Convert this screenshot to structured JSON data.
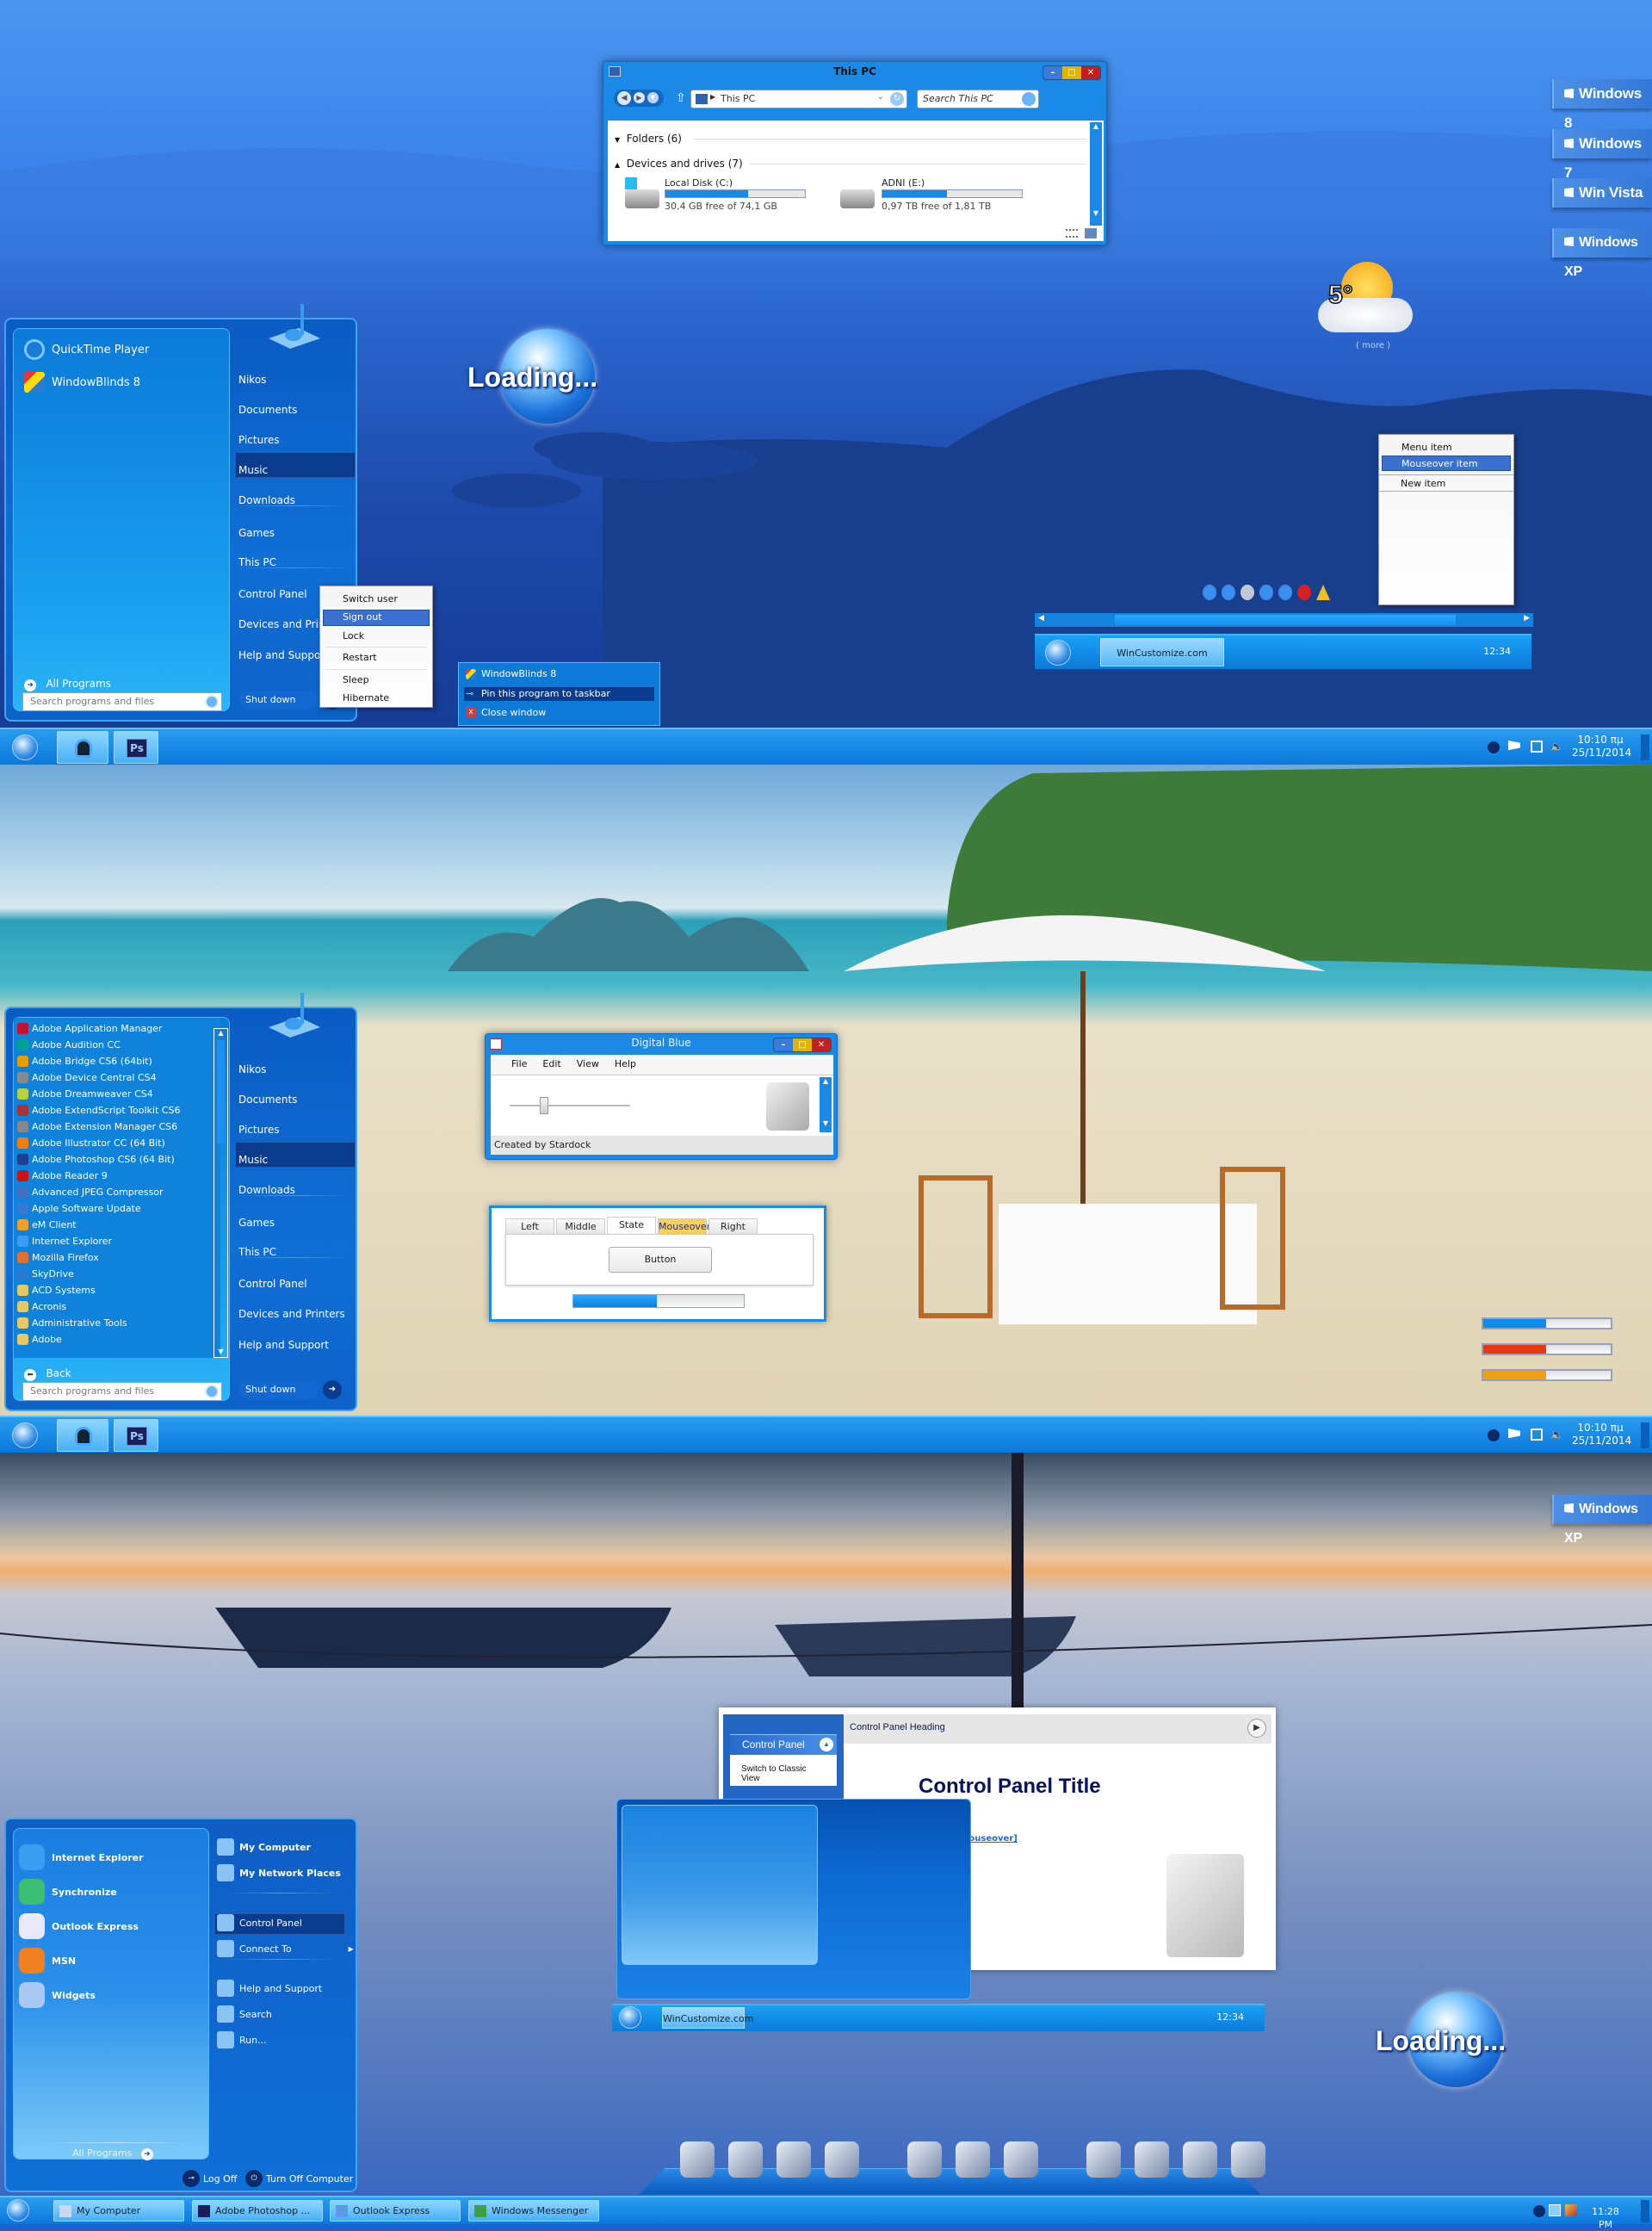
{
  "colors": {
    "accent": "#1a8ae6",
    "highlight": "#0a3b8c",
    "menu_hover": "#3a70d0",
    "progress_blue": "#0d8cee",
    "progress_red": "#e83812",
    "progress_orange": "#f0a010"
  },
  "explorer": {
    "title": "This PC",
    "address": "This PC",
    "search_placeholder": "Search This PC",
    "groups": [
      {
        "label": "Folders (6)",
        "expanded": false
      },
      {
        "label": "Devices and drives (7)",
        "expanded": true
      }
    ],
    "drives": [
      {
        "name": "Local Disk (C:)",
        "free_text": "30,4 GB free of 74,1 GB",
        "used_fraction": 0.59,
        "icon": "windows-drive-icon"
      },
      {
        "name": "ADNI (E:)",
        "free_text": "0,97 TB free of 1,81 TB",
        "used_fraction": 0.46,
        "icon": "hard-drive-icon"
      }
    ]
  },
  "start_menu_1": {
    "pinned": [
      {
        "label": "QuickTime Player",
        "icon": "quicktime-icon"
      },
      {
        "label": "WindowBlinds 8",
        "icon": "windowblinds-icon"
      }
    ],
    "all_programs": "All Programs",
    "search_placeholder": "Search programs and files",
    "right": [
      "Nikos",
      "Documents",
      "Pictures",
      "Music",
      "Downloads",
      "Games",
      "This PC",
      "Control Panel",
      "Devices and Printers",
      "Help and Support"
    ],
    "selected": "Music",
    "shutdown": "Shut down"
  },
  "shutdown_menu": {
    "items": [
      "Switch user",
      "Sign out",
      "Lock",
      "Restart",
      "Sleep",
      "Hibernate"
    ],
    "hover": "Sign out"
  },
  "loading_text": "Loading...",
  "jump_list": {
    "title": "WindowBlinds 8",
    "items": [
      "Pin this program to taskbar",
      "Close window"
    ]
  },
  "desktop_buttons": [
    "Windows 8",
    "Windows 7",
    "Win Vista",
    "Windows XP"
  ],
  "weather": {
    "temp": "5°",
    "more": "( more )",
    "icon": "partly-cloudy-icon"
  },
  "context_menu": {
    "items": [
      "Menu item",
      "Mouseover item",
      "New item"
    ],
    "hover": "Mouseover item"
  },
  "toolbar_icons": [
    "add-icon",
    "forward-icon",
    "new-folder-icon",
    "tag-icon",
    "up-icon",
    "remove-icon",
    "warning-icon"
  ],
  "mini_taskbar": {
    "button": "WinCustomize.com",
    "clock": "12:34"
  },
  "taskbar": {
    "time": "10:10 πμ",
    "date": "25/11/2014",
    "pinned": [
      "user-icon",
      "photoshop-icon"
    ],
    "tray": [
      "show-hidden-icon",
      "action-center-icon",
      "network-icon",
      "volume-icon"
    ]
  },
  "start_menu_2": {
    "programs": [
      "Adobe Application Manager",
      "Adobe Audition CC",
      "Adobe Bridge CS6 (64bit)",
      "Adobe Device Central CS4",
      "Adobe Dreamweaver CS4",
      "Adobe ExtendScript Toolkit CS6",
      "Adobe Extension Manager CS6",
      "Adobe Illustrator CC (64 Bit)",
      "Adobe Photoshop CS6 (64 Bit)",
      "Adobe Reader 9",
      "Advanced JPEG Compressor",
      "Apple Software Update",
      "eM Client",
      "Internet Explorer",
      "Mozilla Firefox",
      "SkyDrive",
      "ACD Systems",
      "Acronis",
      "Administrative Tools",
      "Adobe"
    ],
    "program_colors": [
      "#c8102e",
      "#00a38c",
      "#e89c00",
      "#8a8a8a",
      "#b6d33a",
      "#a33",
      "#888",
      "#ff7b00",
      "#1c3f94",
      "#d01010",
      "#4070c0",
      "#3a78d0",
      "#f0a020",
      "#3a9ef0",
      "#e8702a",
      "#2a7ad0",
      "#e8c860",
      "#e8c860",
      "#e8c860",
      "#e8c860"
    ],
    "back": "Back",
    "search_placeholder": "Search programs and files",
    "right": [
      "Nikos",
      "Documents",
      "Pictures",
      "Music",
      "Downloads",
      "Games",
      "This PC",
      "Control Panel",
      "Devices and Printers",
      "Help and Support"
    ],
    "shutdown": "Shut down"
  },
  "digital_blue": {
    "title": "Digital Blue",
    "menu": [
      "File",
      "Edit",
      "View",
      "Help"
    ],
    "status": "Created by Stardock",
    "slider_value": 0.5
  },
  "tabs_demo": {
    "tabs": [
      "Left",
      "Middle",
      "State",
      "Mouseover",
      "Right"
    ],
    "active": "State",
    "hover": "Mouseover",
    "button": "Button",
    "progress": 0.49
  },
  "progress_bars": [
    {
      "color": "#0d8cee",
      "value": 0.49
    },
    {
      "color": "#e83812",
      "value": 0.49
    },
    {
      "color": "#f0a010",
      "value": 0.49
    }
  ],
  "start_menu_xp": {
    "left": [
      {
        "label": "Internet Explorer",
        "icon": "internet-explorer-icon"
      },
      {
        "label": "Synchronize",
        "icon": "synchronize-icon"
      },
      {
        "label": "Outlook Express",
        "icon": "outlook-express-icon"
      },
      {
        "label": "MSN",
        "icon": "msn-icon"
      },
      {
        "label": "Widgets",
        "icon": "widgets-icon"
      }
    ],
    "all_programs": "All Programs",
    "right_bold": [
      "My Computer",
      "My Network Places"
    ],
    "right": [
      "Control Panel",
      "Connect To",
      "Help and Support",
      "Search",
      "Run..."
    ],
    "selected": "Control Panel",
    "log_off": "Log Off",
    "turn_off": "Turn Off Computer"
  },
  "control_panel": {
    "side_header": "Control Panel",
    "side_link": "Switch to Classic View",
    "heading": "Control Panel Heading",
    "title": "Control Panel Title",
    "link": "mouseover]"
  },
  "taskbar_xp": {
    "buttons": [
      "My Computer",
      "Adobe Photoshop ...",
      "Outlook Express",
      "Windows Messenger"
    ],
    "time": "11:28 PM"
  },
  "dock_icons": [
    "computer-icon",
    "speaker-icon",
    "film-reel-icon",
    "user-icon",
    "camera-icon",
    "paint-icon",
    "search-icon",
    "stopwatch-icon",
    "gem-icon",
    "calculator-icon",
    "recycle-bin-icon"
  ]
}
